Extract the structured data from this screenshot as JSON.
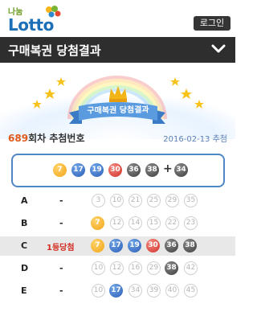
{
  "header": {
    "logo_small": "나눔",
    "logo_main": "Lotto",
    "login_label": "로그인"
  },
  "title_bar": {
    "title": "구매복권 당첨결과"
  },
  "banner": {
    "caption": "구매복권 당첨결과"
  },
  "draw": {
    "round_number": "689",
    "round_suffix": "회차 추첨번호",
    "date": "2016-02-13 추첨"
  },
  "winning_numbers": {
    "main": [
      "7",
      "17",
      "19",
      "30",
      "36",
      "38"
    ],
    "bonus": "34",
    "plus": "+"
  },
  "tickets": [
    {
      "label": "A",
      "rank": "-",
      "numbers": [
        "3",
        "10",
        "21",
        "25",
        "29",
        "35"
      ]
    },
    {
      "label": "B",
      "rank": "-",
      "numbers": [
        "7",
        "12",
        "14",
        "15",
        "22",
        "23"
      ]
    },
    {
      "label": "C",
      "rank": "1등당첨",
      "numbers": [
        "7",
        "17",
        "19",
        "30",
        "36",
        "38"
      ]
    },
    {
      "label": "D",
      "rank": "-",
      "numbers": [
        "10",
        "12",
        "16",
        "29",
        "38",
        "42"
      ]
    },
    {
      "label": "E",
      "rank": "-",
      "numbers": [
        "10",
        "17",
        "34",
        "39",
        "40",
        "45"
      ]
    }
  ],
  "colors": {
    "title_bar_bg": "#2e2e2e",
    "win_box_border": "#4f86c6",
    "ball_yellow": "#f3a417",
    "ball_blue": "#2d5eb7",
    "ball_red": "#d2312a",
    "ball_gray": "#3d3d3d",
    "rank_win": "#d42b1f"
  }
}
